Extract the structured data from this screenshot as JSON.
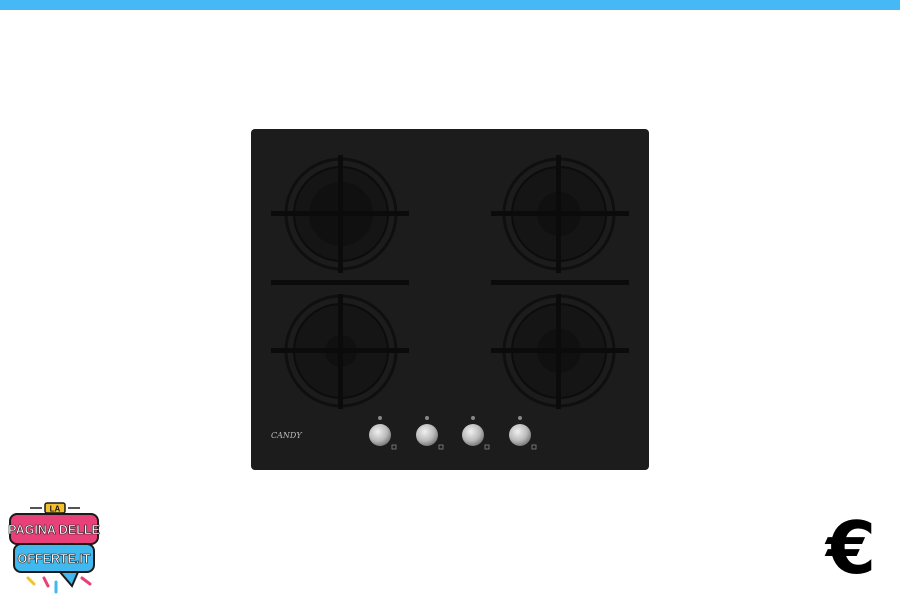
{
  "header": {
    "accent_color": "#45b8f5"
  },
  "product": {
    "brand": "CANDY",
    "image_name": "gas-hob-image",
    "surface_color": "#1c1c1c",
    "burners": 4,
    "knobs": 4
  },
  "logo": {
    "line1": "LA",
    "line2": "PAGINA DELLE",
    "line3": "OFFERTE.IT",
    "colors": {
      "primary": "#e8417a",
      "secondary": "#41b9ef",
      "accent": "#f3c12f"
    }
  },
  "price": {
    "currency_symbol": "€"
  }
}
